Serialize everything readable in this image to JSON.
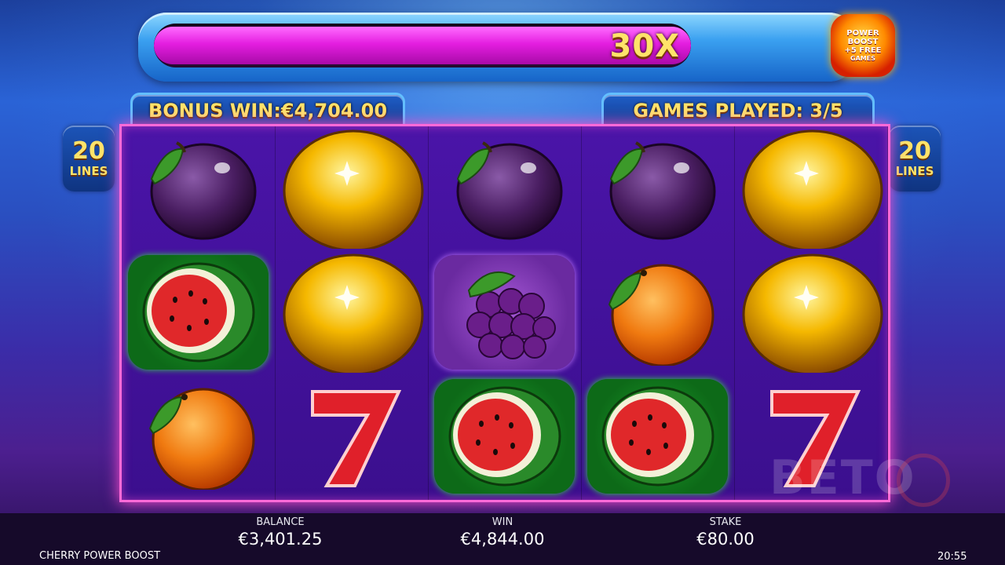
{
  "meter": {
    "multiplier_label": "30X",
    "fill_fraction": 1.0,
    "badge_line1": "POWER",
    "badge_line2": "BOOST",
    "badge_line3": "+5 FREE",
    "badge_line4": "GAMES"
  },
  "bonus_win_label": "BONUS WIN:€4,704.00",
  "games_played_label": "GAMES PLAYED: 3/5",
  "lines": {
    "count": "20",
    "label": "LINES"
  },
  "reels": [
    [
      "plum",
      "watermelon",
      "orange"
    ],
    [
      "golden-apple",
      "golden-apple",
      "seven"
    ],
    [
      "plum",
      "grapes",
      "watermelon"
    ],
    [
      "plum",
      "orange",
      "watermelon"
    ],
    [
      "golden-apple",
      "golden-apple",
      "seven"
    ]
  ],
  "bottom": {
    "balance_label": "BALANCE",
    "balance_value": "€3,401.25",
    "win_label": "WIN",
    "win_value": "€4,844.00",
    "stake_label": "STAKE",
    "stake_value": "€80.00",
    "game_name": "CHERRY POWER BOOST",
    "clock": "20:55"
  },
  "watermark_text": "BETO",
  "colors": {
    "accent_gold": "#ffe36a",
    "meter_fill": "#e41ee0",
    "frame_glow": "#ff6ad8"
  }
}
